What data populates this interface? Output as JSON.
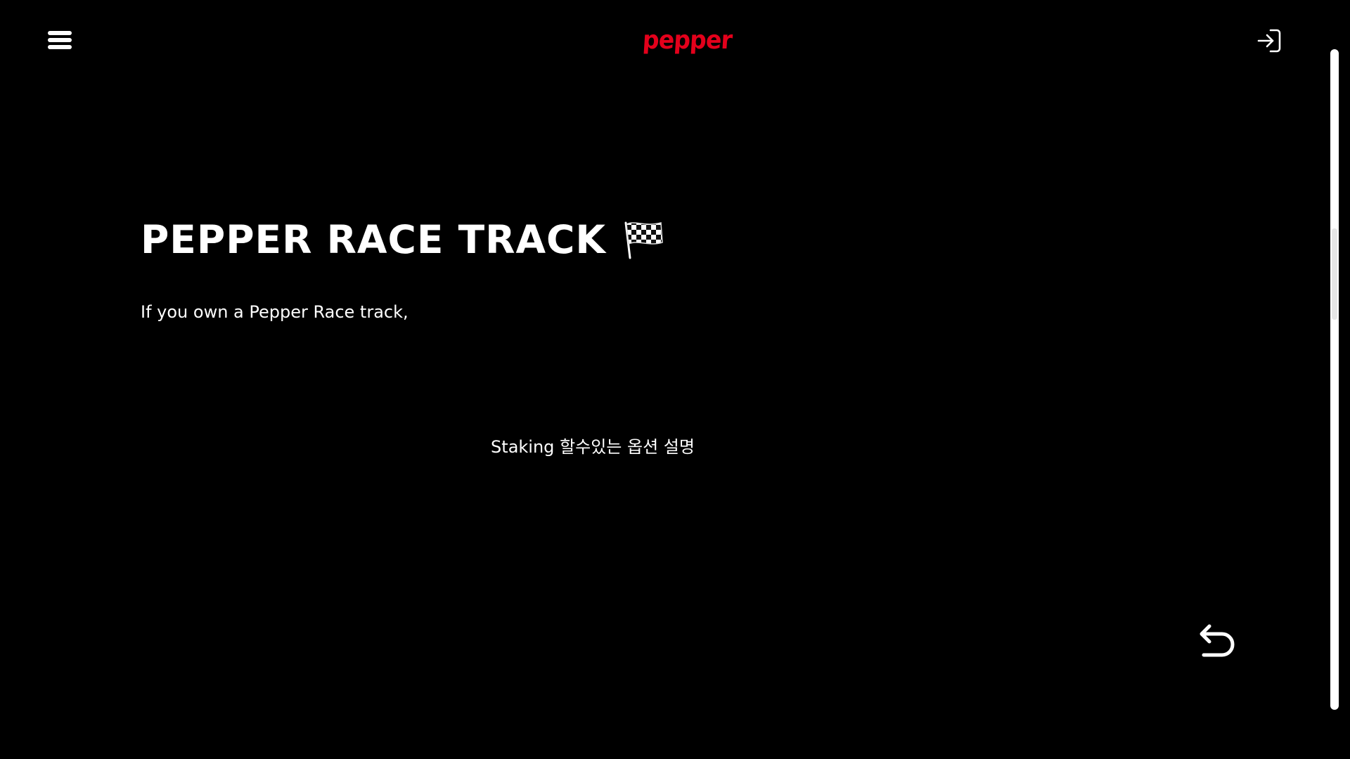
{
  "header": {
    "logo_text": "pepper",
    "menu_icon": "hamburger-menu-icon",
    "login_icon": "sign-in-arrow-icon"
  },
  "main": {
    "title": "PEPPER RACE TRACK",
    "title_icon": "checkered-flag-icon",
    "intro": "If you own a Pepper Race track,",
    "staking_description": "Staking 할수있는 옵션 설명"
  },
  "footer": {
    "back_icon": "undo-arrow-icon"
  },
  "colors": {
    "background": "#000000",
    "text": "#ffffff",
    "brand": "#e3001b"
  }
}
